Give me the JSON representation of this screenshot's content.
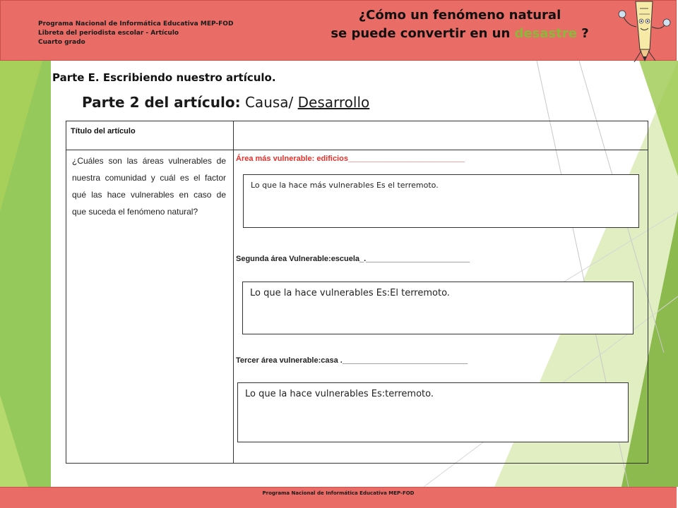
{
  "header": {
    "line1": "Programa Nacional de Informática Educativa MEP-FOD",
    "line2": "Libreta del periodista escolar -  Artículo",
    "line3": "Cuarto grado",
    "title_line1": "¿Cómo un fenómeno natural",
    "title_line2_pre": "se puede convertir en un ",
    "title_highlight": "desastre",
    "title_line2_post": " ?"
  },
  "section": {
    "parte_e": "Parte E. Escribiendo nuestro artículo.",
    "parte2_bold": "Parte 2 del artículo:",
    "parte2_rest": " Causa/ ",
    "parte2_underlined": "Desarrollo"
  },
  "table": {
    "titulo_label": "Título del artículo",
    "question": "¿Cuáles son las áreas vulnerables de nuestra comunidad y cuál es el factor qué las hace vulnerables en caso de que suceda el fenómeno natural?",
    "area1_label": "Área más vulnerable: edificios___________________________",
    "area1_answer": "Lo que la hace más vulnerables Es el terremoto.",
    "area2_label": "Segunda área Vulnerable:escuela_.________________________",
    "area2_answer": "Lo que la hace vulnerables Es:El terremoto.",
    "area3_label": "Tercer área vulnerable:casa ._____________________________",
    "area3_answer": "Lo que la hace vulnerables Es:terremoto."
  },
  "footer": {
    "text": "Programa  Nacional de Informática  Educativa MEP-FOD"
  },
  "colors": {
    "banner": "#e96d66",
    "accent_green": "#8bb83b",
    "label_red": "#e4312b"
  },
  "icons": [
    "pencil-character-icon"
  ]
}
